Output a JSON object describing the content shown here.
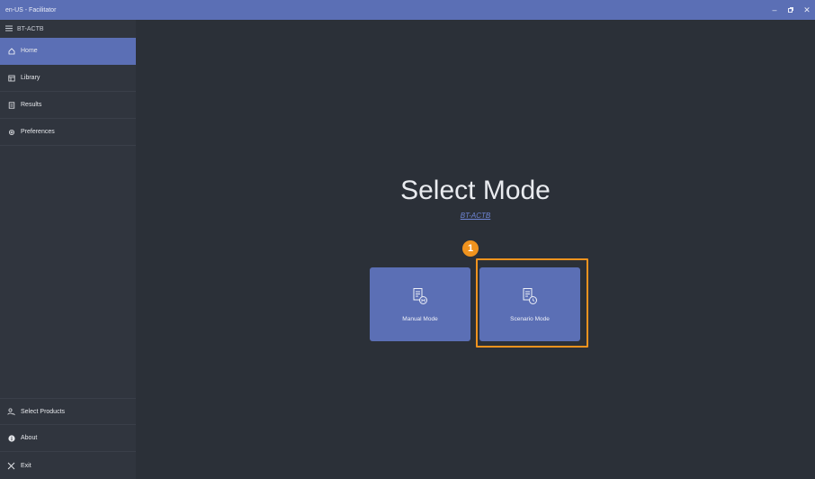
{
  "window": {
    "title": "en-US - Facilitator",
    "minimize_icon": "minimize-icon",
    "restore_icon": "restore-icon",
    "close_icon": "close-icon"
  },
  "sidebar": {
    "header": "BT-ACTB",
    "items": [
      {
        "label": "Home",
        "icon": "home-icon",
        "active": true
      },
      {
        "label": "Library",
        "icon": "library-icon"
      },
      {
        "label": "Results",
        "icon": "results-icon"
      },
      {
        "label": "Preferences",
        "icon": "gear-icon"
      }
    ],
    "bottom_items": [
      {
        "label": "Select Products",
        "icon": "user-select-icon"
      },
      {
        "label": "About",
        "icon": "info-icon"
      },
      {
        "label": "Exit",
        "icon": "close-icon"
      }
    ]
  },
  "main": {
    "title": "Select Mode",
    "subtitle": "BT-ACTB",
    "cards": [
      {
        "label": "Manual Mode",
        "icon": "manual-document-icon"
      },
      {
        "label": "Scenario Mode",
        "icon": "scenario-document-icon"
      }
    ],
    "callout_number": "1"
  },
  "colors": {
    "accent": "#5b6fb5",
    "sidebar_bg": "#30353e",
    "main_bg": "#2b3038",
    "highlight": "#f0931e",
    "link": "#6f86d6"
  }
}
